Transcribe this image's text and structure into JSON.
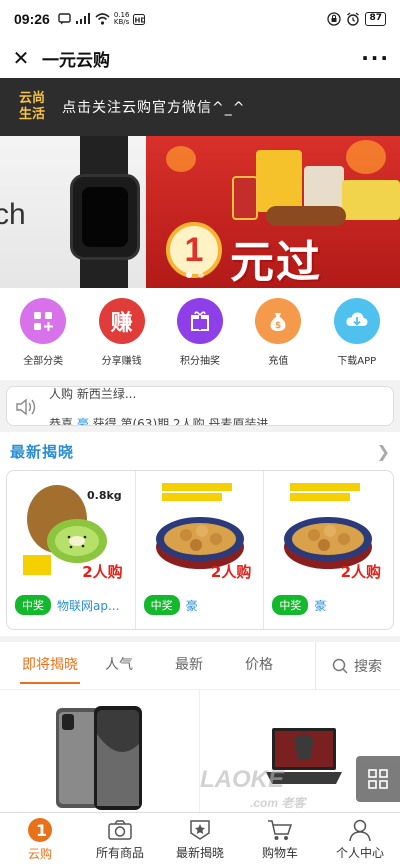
{
  "status_bar": {
    "time": "09:26",
    "speed": "0.16",
    "speed_unit": "KB/s",
    "battery": "87"
  },
  "header": {
    "title": "一元云购"
  },
  "follow_banner": {
    "logo_line1": "云尚",
    "logo_line2": "生活",
    "text": "点击关注云购官方微信^_^"
  },
  "carousel": {
    "left_text": "ch",
    "right_text": "元过",
    "right_digit": "1"
  },
  "categories": [
    {
      "label": "全部分类",
      "icon": "grid-plus-icon",
      "color": "#d772ea"
    },
    {
      "label": "分享赚钱",
      "icon": "zhuan-icon",
      "glyph": "赚",
      "color": "#e03c3a"
    },
    {
      "label": "积分抽奖",
      "icon": "gift-icon",
      "color": "#8f3fe8"
    },
    {
      "label": "充值",
      "icon": "money-bag-icon",
      "color": "#f59a4a"
    },
    {
      "label": "下载APP",
      "icon": "cloud-download-icon",
      "color": "#4fc1ef"
    }
  ],
  "notice": {
    "line1": "人购  新西兰绿...",
    "line2_prefix": "恭喜",
    "line2_highlight": "豪",
    "line2_suffix": " 获得 第(63)期 2人购 丹麦原装进"
  },
  "latest": {
    "title": "最新揭晓",
    "cards": [
      {
        "weight": "0.8kg",
        "count": "2人购",
        "badge": "中奖",
        "winner": "物联网ap..."
      },
      {
        "count": "2人购",
        "badge": "中奖",
        "winner": "豪"
      },
      {
        "count": "2人购",
        "badge": "中奖",
        "winner": "豪"
      }
    ]
  },
  "tabs": {
    "items": [
      "即将揭晓",
      "人气",
      "最新",
      "价格"
    ],
    "active": "即将揭晓",
    "search": "搜索"
  },
  "watermark": {
    "brand": "LAOKE",
    "domain": ".com 老客"
  },
  "bottom_nav": [
    {
      "label": "云购",
      "icon": "yungou-logo-icon",
      "active": true
    },
    {
      "label": "所有商品",
      "icon": "camera-icon"
    },
    {
      "label": "最新揭晓",
      "icon": "star-badge-icon"
    },
    {
      "label": "购物车",
      "icon": "cart-icon"
    },
    {
      "label": "个人中心",
      "icon": "user-icon"
    }
  ]
}
